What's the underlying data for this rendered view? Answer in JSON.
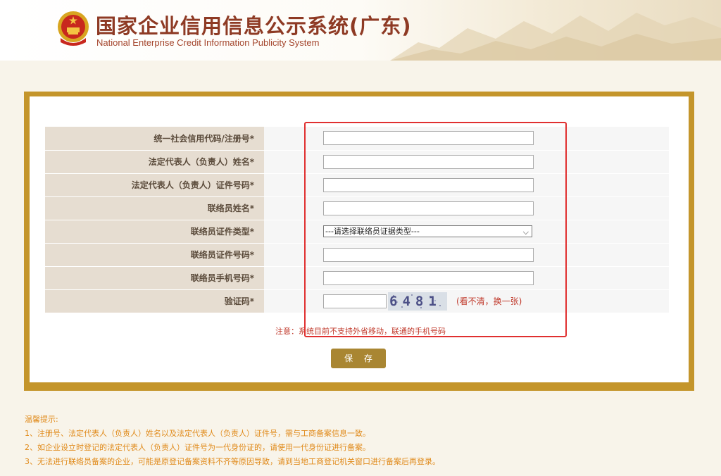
{
  "header": {
    "title_cn": "国家企业信用信息公示系统(广东)",
    "title_en": "National Enterprise Credit Information Publicity System",
    "emblem_icon": "national-emblem-icon"
  },
  "form": {
    "fields": [
      {
        "label": "统一社会信用代码/注册号*",
        "value": ""
      },
      {
        "label": "法定代表人（负责人）姓名*",
        "value": ""
      },
      {
        "label": "法定代表人（负责人）证件号码*",
        "value": ""
      },
      {
        "label": "联络员姓名*",
        "value": ""
      },
      {
        "label": "联络员证件类型*",
        "selected": "---请选择联络员证据类型---"
      },
      {
        "label": "联络员证件号码*",
        "value": ""
      },
      {
        "label": "联络员手机号码*",
        "value": ""
      },
      {
        "label": "验证码*",
        "value": ""
      }
    ],
    "captcha_text": "6481",
    "captcha_refresh": "(看不清，换一张)",
    "notice": "注意：系统目前不支持外省移动，联通的手机号码",
    "save_label": "保 存"
  },
  "tips": {
    "title": "温馨提示:",
    "items": [
      "1、注册号、法定代表人（负责人）姓名以及法定代表人（负责人）证件号，需与工商备案信息一致。",
      "2、如企业设立时登记的法定代表人（负责人）证件号为一代身份证的，请使用一代身份证进行备案。",
      "3、无法进行联络员备案的企业，可能是原登记备案资料不齐等原因导致，请到当地工商登记机关窗口进行备案后再登录。"
    ]
  },
  "colors": {
    "title": "#8e3a24",
    "panel_border": "#c4952b",
    "button": "#a98632",
    "tips": "#e08a1a",
    "notice": "#c0392b",
    "highlight": "#e03030"
  }
}
